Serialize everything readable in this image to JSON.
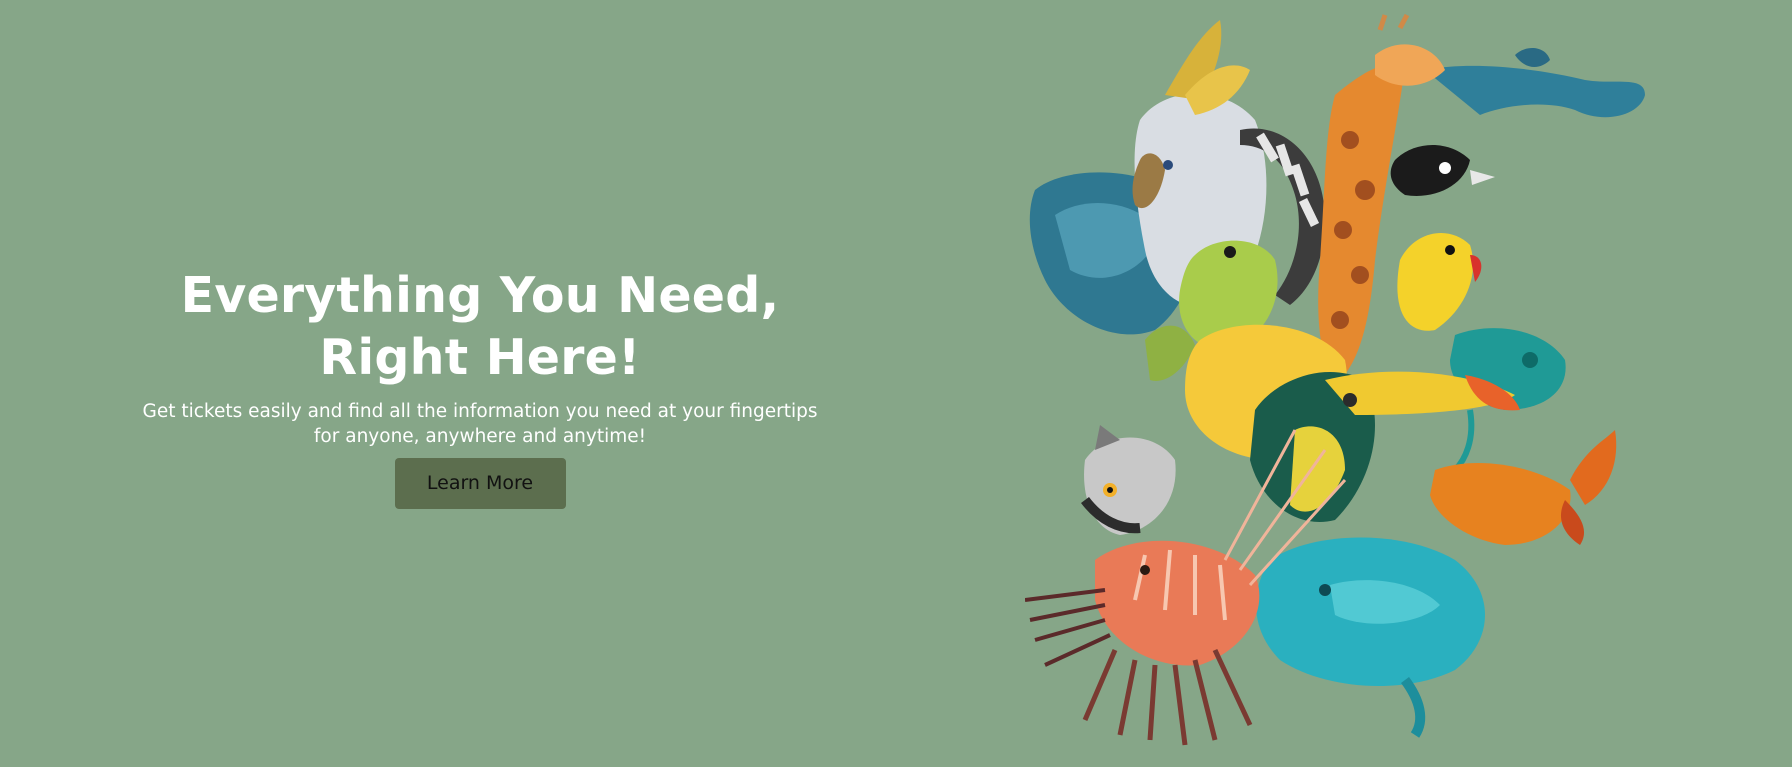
{
  "hero": {
    "title_line1": "Everything You Need,",
    "title_line2": "Right Here!",
    "subtitle_line1": "Get tickets easily and find all the information you need at your fingertips",
    "subtitle_line2": "for anyone, anywhere and anytime!",
    "button_label": "Learn More"
  },
  "colors": {
    "background": "#86a688",
    "button": "#5c6e4e",
    "text": "#ffffff"
  },
  "illustration": {
    "icon": "animal-collage-illustration"
  }
}
